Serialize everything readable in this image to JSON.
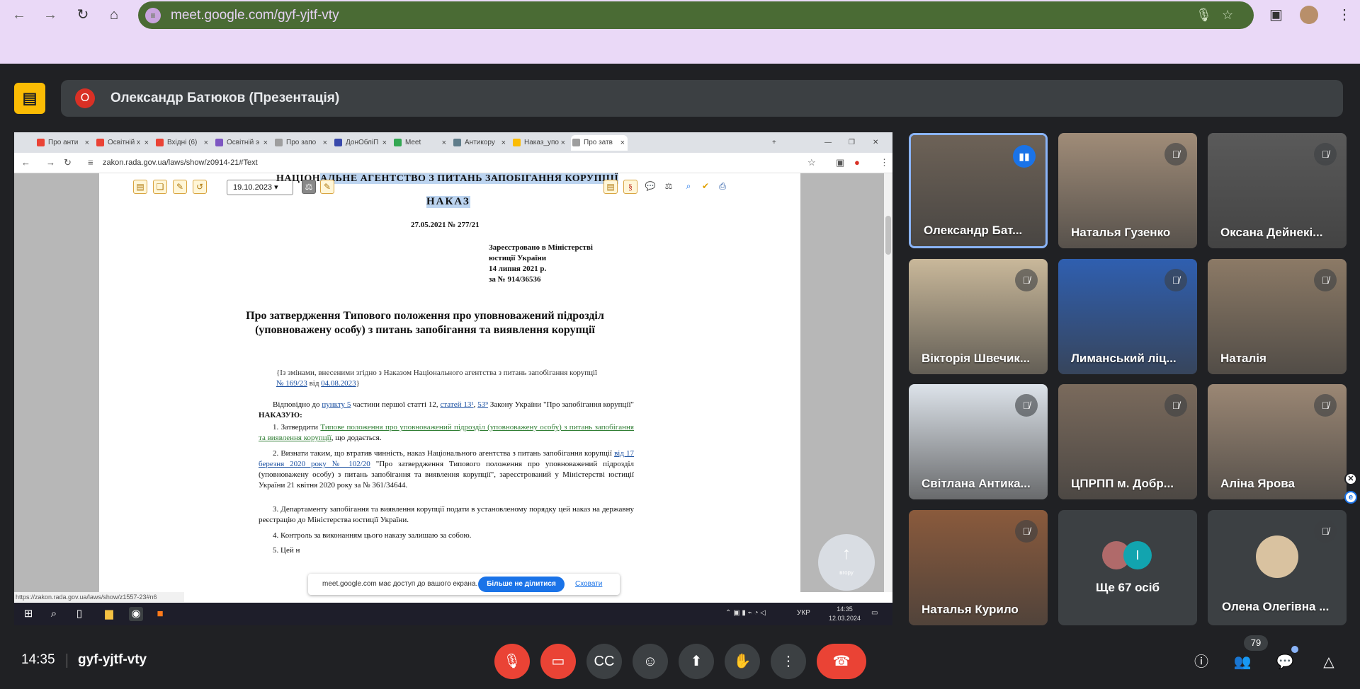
{
  "browser": {
    "url": "meet.google.com/gyf-yjtf-vty"
  },
  "presenter": {
    "initial": "О",
    "title": "Олександр Батюков (Презентація)"
  },
  "shared_screen": {
    "tabs": [
      {
        "label": "Про анти",
        "color": "#ea4335"
      },
      {
        "label": "Освітній х",
        "color": "#ea4335"
      },
      {
        "label": "Вхідні (6)",
        "color": "#ea4335"
      },
      {
        "label": "Освітній э",
        "color": "#7e57c2"
      },
      {
        "label": "Про запо",
        "color": "#9e9e9e"
      },
      {
        "label": "ДонОбліП",
        "color": "#3949ab"
      },
      {
        "label": "Meet",
        "color": "#34a853"
      },
      {
        "label": "Антикору",
        "color": "#607d8b"
      },
      {
        "label": "Наказ_упо",
        "color": "#fbbc04"
      },
      {
        "label": "Про затв",
        "color": "#9e9e9e"
      }
    ],
    "address": "zakon.rada.gov.ua/laws/show/z0914-21#Text",
    "date_select": "19.10.2023",
    "doc": {
      "agency_pre": "НАЦІОН",
      "agency_hl": "АЛЬНЕ АГЕНТСТВО З ПИТАНЬ ЗАПОБІГАННЯ КОРУПЦІЇ",
      "order_title": "НАКАЗ",
      "number": "27.05.2021  № 277/21",
      "reg1": "Зареєстровано в Міністерстві",
      "reg2": "юстиції України",
      "reg3": "14 липня 2021 р.",
      "reg4": "за № 914/36536",
      "heading": "Про затвердження Типового положення про уповноважений підрозділ (уповноважену особу) з питань запобігання та виявлення корупції",
      "note_text": "{Із змінами, внесеними згідно з Наказом Національного агентства з питань запобігання корупції",
      "note_link1": "№ 169/23",
      "note_mid": " від ",
      "note_link2": "04.08.2023",
      "note_end": "}",
      "p1_a": "Відповідно до ",
      "p1_link1": "пункту 5",
      "p1_b": " частини першої статті 12, ",
      "p1_link2": "статей 13¹",
      "p1_c": ", ",
      "p1_link3": "53⁹",
      "p1_d": " Закону України \"Про запобігання корупції\" ",
      "p1_bold": "НАКАЗУЮ:",
      "p2_a": "1. Затвердити ",
      "p2_link": "Типове положення про уповноважений підрозділ (уповноважену особу) з питань запобігання та виявлення корупції",
      "p2_b": ", що додається.",
      "p3_a": "2. Визнати таким, що втратив чинність, наказ Національного агентства з питань запобігання корупції ",
      "p3_link": "від 17 березня 2020 року № 102/20",
      "p3_b": " \"Про затвердження Типового положення про уповноважений підрозділ (уповноважену особу) з питань запобігання та виявлення корупції\", зареєстрований у Міністерстві юстиції України 21 квітня 2020 року за № 361/34644.",
      "p4": "3. Департаменту запобігання та виявлення корупції подати в установленому порядку цей наказ на державну реєстрацію до Міністерства юстиції України.",
      "p5": "4. Контроль за виконанням цього наказу залишаю за собою.",
      "p6": "5. Цей н"
    },
    "scroll_up_label": "вгору",
    "share_notice": "meet.google.com має доступ до вашого екрана.",
    "stop_sharing": "Більше не ділитися",
    "hide": "Сховати",
    "status_url": "https://zakon.rada.gov.ua/laws/show/z1557-23#n6",
    "tray_lang": "УКР",
    "tray_time": "14:35",
    "tray_date": "12.03.2024"
  },
  "participants": [
    {
      "name": "Олександр Бат...",
      "speaking": true,
      "bg": "#6d6257"
    },
    {
      "name": "Наталья Гузенко",
      "speaking": false,
      "bg": "#a08c78"
    },
    {
      "name": "Оксана Дейнекі...",
      "speaking": false,
      "bg": "#5a5a5a"
    },
    {
      "name": "Вікторія Швечик...",
      "speaking": false,
      "bg": "#c9b89a"
    },
    {
      "name": "Лиманський ліц...",
      "speaking": false,
      "bg": "#2f5fb0"
    },
    {
      "name": "Наталія",
      "speaking": false,
      "bg": "#8c7a66"
    },
    {
      "name": "Світлана Антика...",
      "speaking": false,
      "bg": "#dde3ea"
    },
    {
      "name": "ЦПРПП м. Добр...",
      "speaking": false,
      "bg": "#7a6a5c"
    },
    {
      "name": "Аліна Ярова",
      "speaking": false,
      "bg": "#9b8774"
    },
    {
      "name": "Наталья Курило",
      "speaking": false,
      "bg": "#8a5a3c"
    }
  ],
  "more_tile": {
    "label": "Ще 67 осіб",
    "initial": "І"
  },
  "olena_tile": {
    "name": "Олена Олегівна ..."
  },
  "bottom": {
    "time": "14:35",
    "meeting_code": "gyf-yjtf-vty",
    "people_count": "79"
  }
}
